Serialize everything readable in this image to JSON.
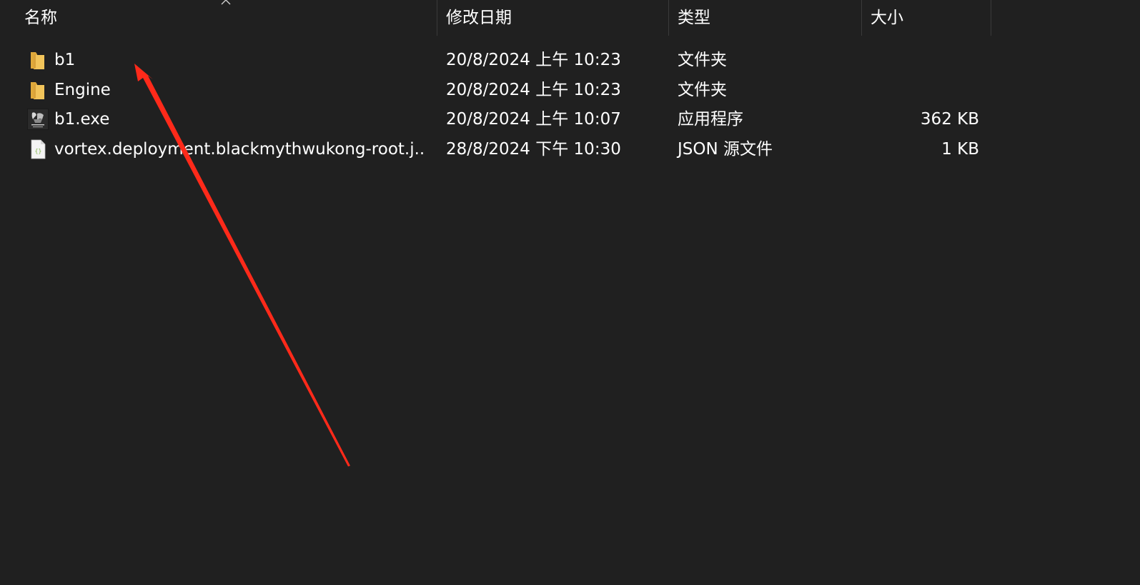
{
  "columns": {
    "name": "名称",
    "modified": "修改日期",
    "type": "类型",
    "size": "大小"
  },
  "files": [
    {
      "name": "b1",
      "modified": "20/8/2024 上午 10:23",
      "type": "文件夹",
      "size": "",
      "icon": "folder-icon"
    },
    {
      "name": "Engine",
      "modified": "20/8/2024 上午 10:23",
      "type": "文件夹",
      "size": "",
      "icon": "folder-icon"
    },
    {
      "name": "b1.exe",
      "modified": "20/8/2024 上午 10:07",
      "type": "应用程序",
      "size": "362 KB",
      "icon": "wukong-app-icon"
    },
    {
      "name": "vortex.deployment.blackmythwukong-root.j...",
      "modified": "28/8/2024 下午 10:30",
      "type": "JSON 源文件",
      "size": "1 KB",
      "icon": "json-file-icon"
    }
  ],
  "colors": {
    "background": "#202020",
    "folder": "#f2c45a",
    "annotation_arrow": "#ff2a1a"
  }
}
